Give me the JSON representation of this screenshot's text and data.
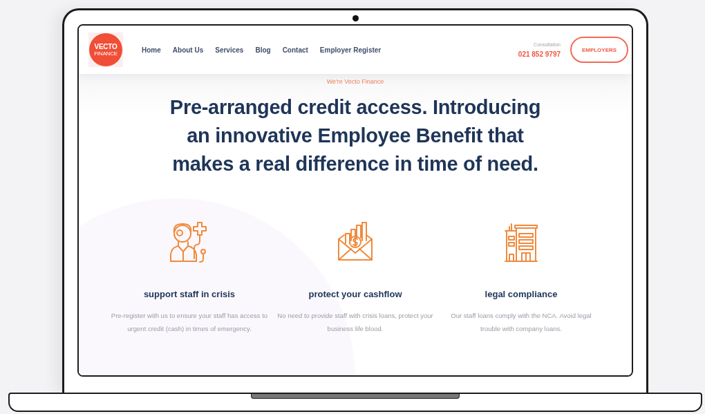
{
  "logo": {
    "name": "VECTO",
    "tagline": "FINANCE"
  },
  "nav": [
    {
      "label": "Home"
    },
    {
      "label": "About Us"
    },
    {
      "label": "Services"
    },
    {
      "label": "Blog"
    },
    {
      "label": "Contact"
    },
    {
      "label": "Employer Register"
    }
  ],
  "contact": {
    "label": "Consultation",
    "phone": "021 852 9797"
  },
  "cta_button": "EMPLOYERS",
  "hero": {
    "eyebrow": "We're Vecto Finance",
    "headline": "Pre-arranged credit access. Introducing an innovative Employee Benefit that makes a real difference in time of need."
  },
  "features": [
    {
      "kind": "doctor",
      "title": "support staff in crisis",
      "text": "Pre-register with us to ensure your staff has access to urgent credit (cash) in times of emergency."
    },
    {
      "kind": "envelope",
      "title": "protect your cashflow",
      "text": "No need to provide staff with crisis loans, protect your business life blood."
    },
    {
      "kind": "building",
      "title": "legal compliance",
      "text": "Our staff loans comply with the NCA. Avoid legal trouble with company loans."
    }
  ]
}
